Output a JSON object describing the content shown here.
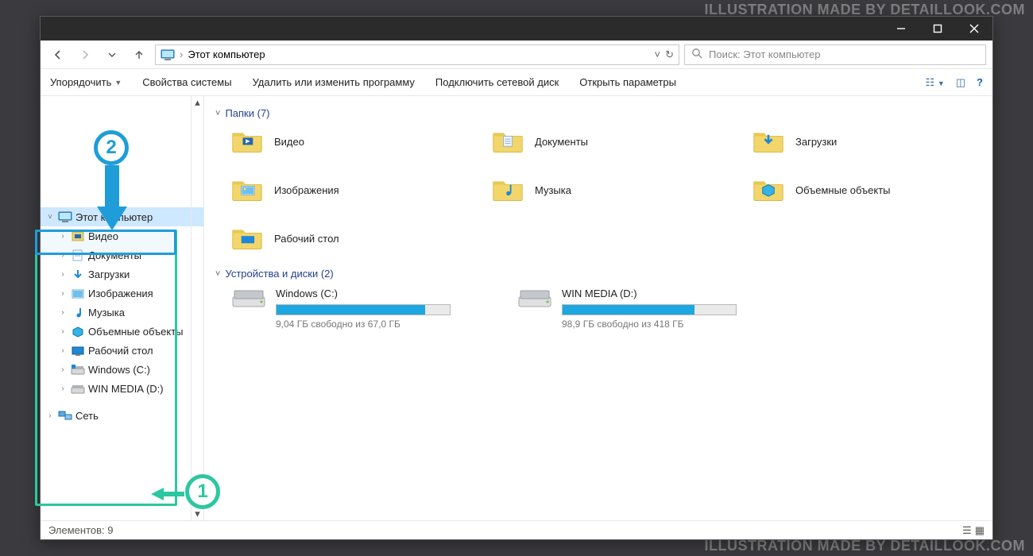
{
  "watermark": "ILLUSTRATION MADE BY DETAILLOOK.COM",
  "addressbar": {
    "location": "Этот компьютер",
    "search_placeholder": "Поиск: Этот компьютер"
  },
  "commandbar": {
    "organize": "Упорядочить",
    "system_props": "Свойства системы",
    "uninstall": "Удалить или изменить программу",
    "map_drive": "Подключить сетевой диск",
    "open_settings": "Открыть параметры"
  },
  "tree": {
    "this_pc": "Этот компьютер",
    "children": [
      "Видео",
      "Документы",
      "Загрузки",
      "Изображения",
      "Музыка",
      "Объемные объекты",
      "Рабочий стол",
      "Windows (C:)",
      "WIN MEDIA (D:)"
    ],
    "network": "Сеть"
  },
  "groups": {
    "folders_hdr": "Папки (7)",
    "drives_hdr": "Устройства и диски (2)"
  },
  "folders": [
    "Видео",
    "Документы",
    "Загрузки",
    "Изображения",
    "Музыка",
    "Объемные объекты",
    "Рабочий стол"
  ],
  "drives": [
    {
      "name": "Windows (C:)",
      "free_text": "9,04 ГБ свободно из 67,0 ГБ",
      "fill_pct": 86
    },
    {
      "name": "WIN MEDIA (D:)",
      "free_text": "98,9 ГБ свободно из 418 ГБ",
      "fill_pct": 76
    }
  ],
  "status": {
    "count_text": "Элементов: 9"
  },
  "annotations": {
    "badge1": "1",
    "badge2": "2"
  }
}
